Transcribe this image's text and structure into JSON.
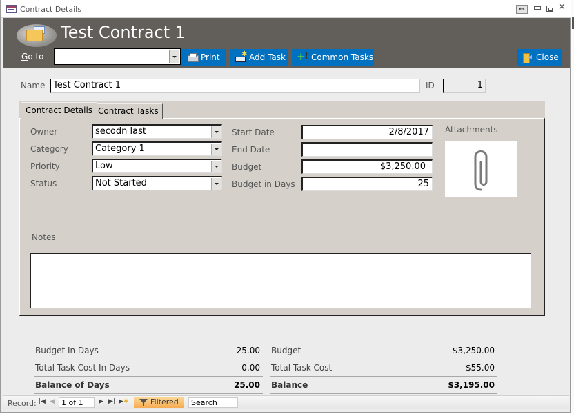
{
  "window": {
    "title": "Contract Details",
    "controls": {
      "resize_glyph": "↔"
    }
  },
  "header": {
    "form_title": "Test Contract 1",
    "goto_label_access_key": "G",
    "goto_label_rest": "o to",
    "goto_value": "",
    "buttons": {
      "print": {
        "access_key": "P",
        "rest": "rint"
      },
      "add_task": {
        "access_key": "A",
        "rest": "dd Task"
      },
      "common_tasks": {
        "prefix": "C",
        "access_key": "o",
        "rest": "mmon Tasks"
      },
      "close": {
        "access_key": "C",
        "rest": "lose"
      }
    },
    "colors": {
      "header_bg": "#625f5a",
      "button_bg": "#0070c0"
    }
  },
  "record": {
    "name_label": "Name",
    "name_value": "Test Contract 1",
    "id_label": "ID",
    "id_value": "1"
  },
  "tabs": [
    {
      "label": "Contract Details",
      "active": true
    },
    {
      "label": "Contract Tasks",
      "active": false
    }
  ],
  "details": {
    "owner": {
      "label": "Owner",
      "value": "secodn last"
    },
    "category": {
      "label": "Category",
      "value": "Category 1"
    },
    "priority": {
      "label": "Priority",
      "value": "Low"
    },
    "status": {
      "label": "Status",
      "value": "Not Started"
    },
    "start_date": {
      "label": "Start Date",
      "value": "2/8/2017"
    },
    "end_date": {
      "label": "End Date",
      "value": ""
    },
    "budget": {
      "label": "Budget",
      "value": "$3,250.00"
    },
    "budget_days": {
      "label": "Budget in Days",
      "value": "25"
    },
    "attachments_label": "Attachments",
    "notes_label": "Notes",
    "notes_value": ""
  },
  "summary": {
    "days": [
      {
        "label": "Budget In Days",
        "value": "25.00",
        "bold": false
      },
      {
        "label": "Total Task Cost In Days",
        "value": "0.00",
        "bold": false
      },
      {
        "label": "Balance of Days",
        "value": "25.00",
        "bold": true
      }
    ],
    "money": [
      {
        "label": "Budget",
        "value": "$3,250.00",
        "bold": false
      },
      {
        "label": "Total Task Cost",
        "value": "$55.00",
        "bold": false
      },
      {
        "label": "Balance",
        "value": "$3,195.00",
        "bold": true
      }
    ]
  },
  "navigation": {
    "record_label": "Record:",
    "position": "1 of 1",
    "filter_label": "Filtered",
    "search_placeholder": "Search"
  }
}
